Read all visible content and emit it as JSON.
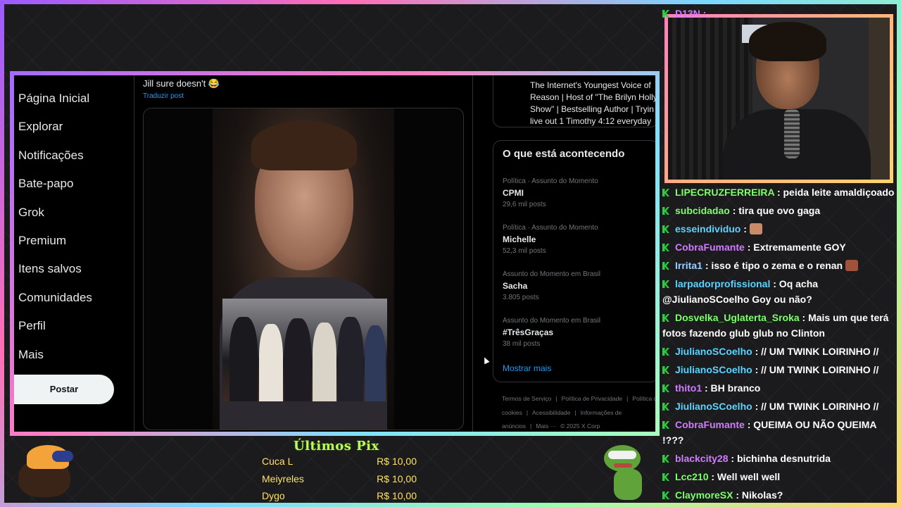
{
  "nav": {
    "items": [
      "Página Inicial",
      "Explorar",
      "Notificações",
      "Bate-papo",
      "Grok",
      "Premium",
      "Itens salvos",
      "Comunidades",
      "Perfil",
      "Mais"
    ],
    "post_button": "Postar"
  },
  "tweet": {
    "text": "Jill sure doesn't 😂",
    "translate": "Traduzir post"
  },
  "profile_bio": "The Internet's Youngest Voice of\nReason | Host of \"The Brilyn Holly\nShow\" | Bestselling Author | Tryin\nlive out 1 Timothy 4:12 everyday",
  "trends": {
    "title": "O que está acontecendo",
    "items": [
      {
        "category": "Política · Assunto do Momento",
        "name": "CPMI",
        "count": "29,6 mil posts"
      },
      {
        "category": "Política · Assunto do Momento",
        "name": "Michelle",
        "count": "52,3 mil posts"
      },
      {
        "category": "Assunto do Momento em Brasil",
        "name": "Sacha",
        "count": "3.805 posts"
      },
      {
        "category": "Assunto do Momento em Brasil",
        "name": "#TrêsGraças",
        "count": "38 mil posts"
      }
    ],
    "show_more": "Mostrar mais"
  },
  "footer": {
    "links": [
      "Termos de Serviço",
      "|",
      "Política de Privacidade",
      "|",
      "Política de cookies",
      "|",
      "Acessibilidade",
      "|",
      "Informações de anúncios",
      "|",
      "Mais ···",
      "© 2025 X Corp"
    ]
  },
  "chat": {
    "top_user": "D13N :",
    "messages": [
      {
        "user": "LIPECRUZFERREIRA",
        "color": "#7dff6b",
        "text": ": peida leite amaldiçoado",
        "emote": ""
      },
      {
        "user": "subcidadao",
        "color": "#7dff6b",
        "text": ": tira que ovo gaga",
        "emote": ""
      },
      {
        "user": "esseindividuo",
        "color": "#5cd3ff",
        "text": ":",
        "emote": "#c98a6a"
      },
      {
        "user": "CobraFumante",
        "color": "#d27bff",
        "text": ": Extremamente GOY",
        "emote": ""
      },
      {
        "user": "Irrita1",
        "color": "#9ad0ff",
        "text": ": isso é tipo o zema e o renan",
        "emote": "#a0523a"
      },
      {
        "user": "larpadorprofissional",
        "color": "#5cd3ff",
        "text": ": Oq acha @JiulianoSCoelho Goy ou não?",
        "emote": ""
      },
      {
        "user": "Dosvelka_Uglaterta_Sroka",
        "color": "#7dff6b",
        "text": ": Mais um que terá fotos fazendo glub glub no Clinton",
        "emote": ""
      },
      {
        "user": "JiulianoSCoelho",
        "color": "#5cd3ff",
        "text": ": // UM TWINK LOIRINHO //",
        "emote": ""
      },
      {
        "user": "JiulianoSCoelho",
        "color": "#5cd3ff",
        "text": ": // UM TWINK LOIRINHO //",
        "emote": ""
      },
      {
        "user": "thito1",
        "color": "#d27bff",
        "text": ": BH branco",
        "emote": ""
      },
      {
        "user": "JiulianoSCoelho",
        "color": "#5cd3ff",
        "text": ": // UM TWINK LOIRINHO //",
        "emote": ""
      },
      {
        "user": "CobraFumante",
        "color": "#d27bff",
        "text": ": QUEIMA OU NÃO QUEIMA !???",
        "emote": ""
      },
      {
        "user": "blackcity28",
        "color": "#d27bff",
        "text": ": bichinha desnutrida",
        "emote": ""
      },
      {
        "user": "Lcc210",
        "color": "#7dff6b",
        "text": ": Well well well",
        "emote": ""
      },
      {
        "user": "ClaymoreSX",
        "color": "#7dff6b",
        "text": ": Nikolas?",
        "emote": ""
      }
    ]
  },
  "tips": {
    "title": "Últimos Pix",
    "rows": [
      {
        "name": "Cuca L",
        "amount": "R$ 10,00"
      },
      {
        "name": "Meiyreles",
        "amount": "R$ 10,00"
      },
      {
        "name": "Dygo",
        "amount": "R$ 10,00"
      }
    ]
  }
}
